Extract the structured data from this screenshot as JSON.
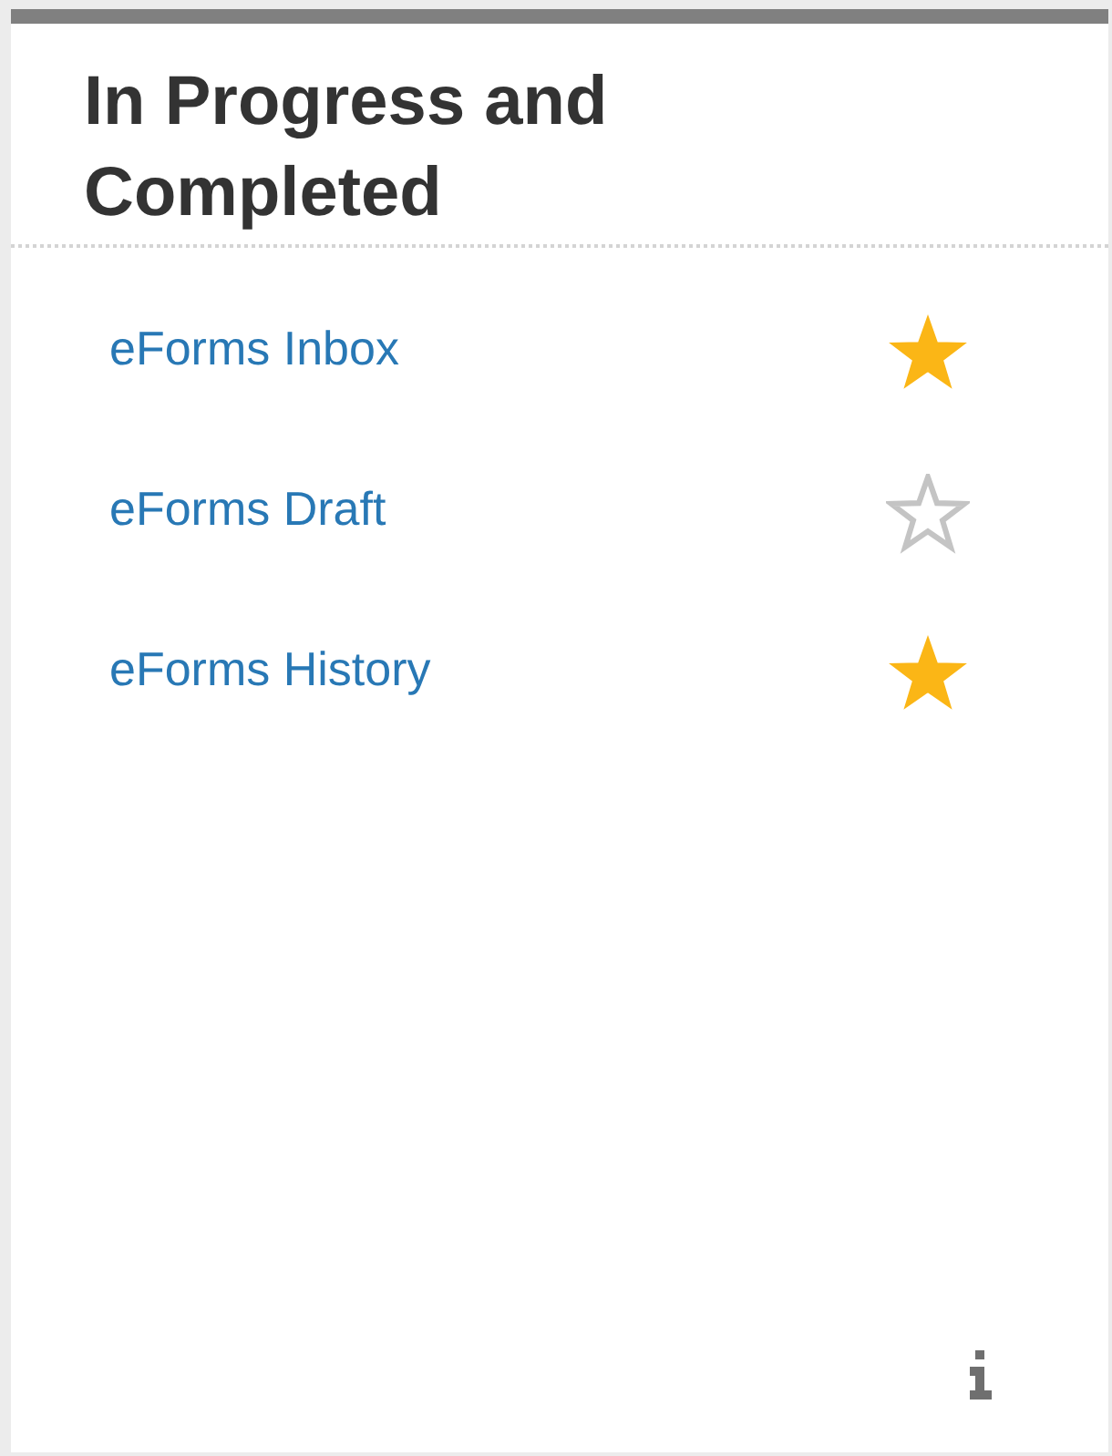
{
  "panel": {
    "title": "In Progress and Completed",
    "links": [
      {
        "label": "eForms Inbox",
        "favorite": true
      },
      {
        "label": "eForms Draft",
        "favorite": false
      },
      {
        "label": "eForms History",
        "favorite": true
      }
    ]
  }
}
